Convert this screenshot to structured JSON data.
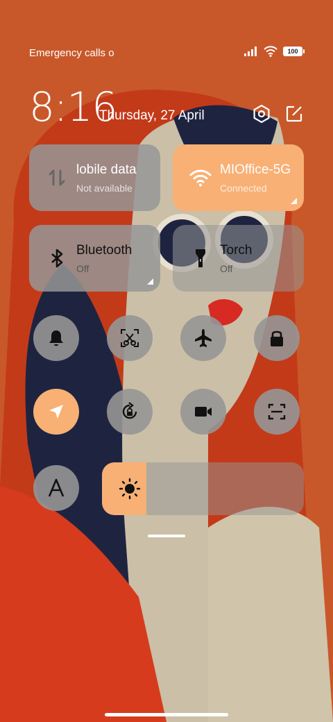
{
  "status_bar": {
    "carrier_text": "Emergency calls o",
    "battery_level": "100",
    "signal_icon": "signal-bars-icon",
    "wifi_icon": "wifi-icon"
  },
  "header": {
    "time": "8:16",
    "date": "Thursday, 27 April",
    "settings_icon": "settings-icon",
    "edit_icon": "edit-icon"
  },
  "tiles": {
    "mobile_data": {
      "title": "lobile data",
      "subtitle": "Not available",
      "icon": "mobile-data-icon"
    },
    "wifi": {
      "title": "MIOffice-5G",
      "subtitle": "Connected",
      "icon": "wifi-icon"
    },
    "bluetooth": {
      "title": "Bluetooth",
      "subtitle": "Off",
      "icon": "bluetooth-icon"
    },
    "torch": {
      "title": "Torch",
      "subtitle": "Off",
      "icon": "torch-icon"
    }
  },
  "toggles": [
    {
      "name": "ring-toggle",
      "icon": "bell-icon",
      "active": false
    },
    {
      "name": "screenshot-toggle",
      "icon": "scissors-icon",
      "active": false
    },
    {
      "name": "airplane-mode-toggle",
      "icon": "airplane-icon",
      "active": false
    },
    {
      "name": "lock-screen-toggle",
      "icon": "lock-icon",
      "active": false
    },
    {
      "name": "location-toggle",
      "icon": "location-arrow-icon",
      "active": true
    },
    {
      "name": "auto-rotate-toggle",
      "icon": "rotation-lock-icon",
      "active": false
    },
    {
      "name": "screen-recorder-toggle",
      "icon": "video-camera-icon",
      "active": false
    },
    {
      "name": "scanner-toggle",
      "icon": "scan-icon",
      "active": false
    },
    {
      "name": "reading-mode-toggle",
      "icon": "font-a-icon",
      "active": false
    }
  ],
  "brightness": {
    "level_percent": 22,
    "icon": "sun-icon"
  },
  "colors": {
    "accent": "#f8b075",
    "tile_gray": "#969696",
    "wallpaper_bg": "#c8582a"
  }
}
